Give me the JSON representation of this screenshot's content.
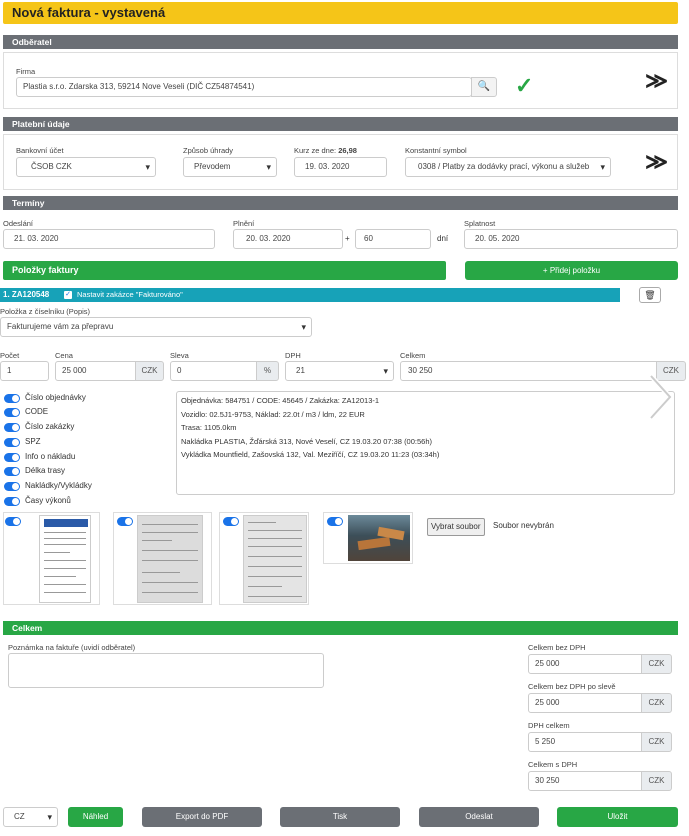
{
  "page": {
    "title": "Nová faktura - vystavená"
  },
  "odberatel": {
    "header": "Odběratel",
    "firma_label": "Firma",
    "firma_value": "Plastia s.r.o. Zdarska 313, 59214 Nove Veseli (DIČ CZ54874541)"
  },
  "platebni": {
    "header": "Platební údaje",
    "bank_label": "Bankovní účet",
    "bank_value": "ČSOB CZK",
    "zpusob_label": "Způsob úhrady",
    "zpusob_value": "Převodem",
    "kurz_label_prefix": "Kurz ze dne: ",
    "kurz_label_value": "26,98",
    "kurz_date": "19. 03. 2020",
    "konst_label": "Konstantní symbol",
    "konst_value": "0308 / Platby za dodávky prací, výkonu a služeb"
  },
  "terminy": {
    "header": "Termíny",
    "odeslani_label": "Odeslání",
    "odeslani_value": "21. 03. 2020",
    "plneni_label": "Plnění",
    "plneni_value": "20. 03. 2020",
    "plus": "+",
    "dni_value": "60",
    "dni_label": "dní",
    "splatnost_label": "Splatnost",
    "splatnost_value": "20. 05. 2020"
  },
  "polozky": {
    "header": "Položky faktury",
    "add_button": "+ Přidej položku",
    "item_title": "1. ZA120548",
    "item_check_label": "Nastavit zakázce \"Fakturováno\"",
    "ciselnik_label": "Položka z číselníku (Popis)",
    "ciselnik_value": "Fakturujeme vám za přepravu",
    "pocet_label": "Počet",
    "pocet_value": "1",
    "cena_label": "Cena",
    "cena_value": "25 000",
    "cena_unit": "CZK",
    "sleva_label": "Sleva",
    "sleva_value": "0",
    "sleva_unit": "%",
    "dph_label": "DPH",
    "dph_value": "21",
    "celkem_label": "Celkem",
    "celkem_value": "30 250",
    "celkem_unit": "CZK",
    "toggles": [
      "Číslo objednávky",
      "CODE",
      "Číslo zakázky",
      "SPZ",
      "Info o nákladu",
      "Délka trasy",
      "Nakládky/Vykládky",
      "Časy výkonů"
    ],
    "desc_lines": [
      "Objednávka: 584751 / CODE: 45645 / Zakázka: ZA12013-1",
      "Vozidlo: 02.5J1-9753, Náklad: 22.0t / m3 / ldm, 22 EUR",
      "Trasa: 1105.0km",
      "Nakládka PLASTIA, Žďárská 313, Nové Veselí, CZ 19.03.20 07:38 (00:56h)",
      "Vykládka Mountfield, Zašovská 132, Val. Meziříčí, CZ 19.03.20 11:23 (03:34h)"
    ],
    "file_button": "Vybrat soubor",
    "file_status": "Soubor nevybrán"
  },
  "celkem": {
    "header": "Celkem",
    "poznamka_label": "Poznámka na faktuře (uvidí odběratel)",
    "bez_dph_label": "Celkem bez DPH",
    "bez_dph_value": "25 000",
    "po_sleve_label": "Celkem bez DPH po slevě",
    "po_sleve_value": "25 000",
    "dph_label": "DPH celkem",
    "dph_value": "5 250",
    "s_dph_label": "Celkem s DPH",
    "s_dph_value": "30 250",
    "unit": "CZK"
  },
  "footer": {
    "lang": "CZ",
    "nahled": "Náhled",
    "export": "Export do PDF",
    "tisk": "Tisk",
    "odeslat": "Odeslat",
    "ulozit": "Uložit"
  },
  "colors": {
    "title_bar": "#f5c518",
    "section": "#6b6f75",
    "green": "#28a745",
    "teal": "#17a2b8",
    "toggle": "#1a73e8"
  }
}
